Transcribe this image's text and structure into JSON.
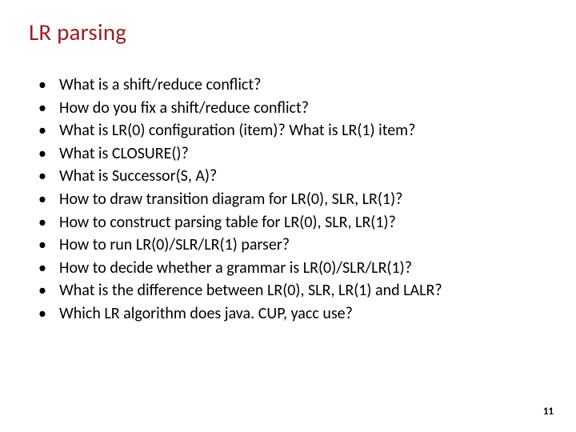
{
  "title": "LR parsing",
  "bullets": [
    "What is a shift/reduce conflict?",
    "How do you fix a shift/reduce conflict?",
    "What is LR(0) configuration (item)? What is LR(1) item?",
    "What is CLOSURE()?",
    "What is Successor(S, A)?",
    "How to draw transition diagram for LR(0), SLR, LR(1)?",
    "How to construct parsing table for LR(0), SLR, LR(1)?",
    "How to run LR(0)/SLR/LR(1) parser?",
    "How to decide whether a grammar is LR(0)/SLR/LR(1)?",
    "What is the difference between LR(0), SLR, LR(1) and LALR?",
    "Which LR algorithm does java. CUP, yacc use?"
  ],
  "page_number": "11"
}
